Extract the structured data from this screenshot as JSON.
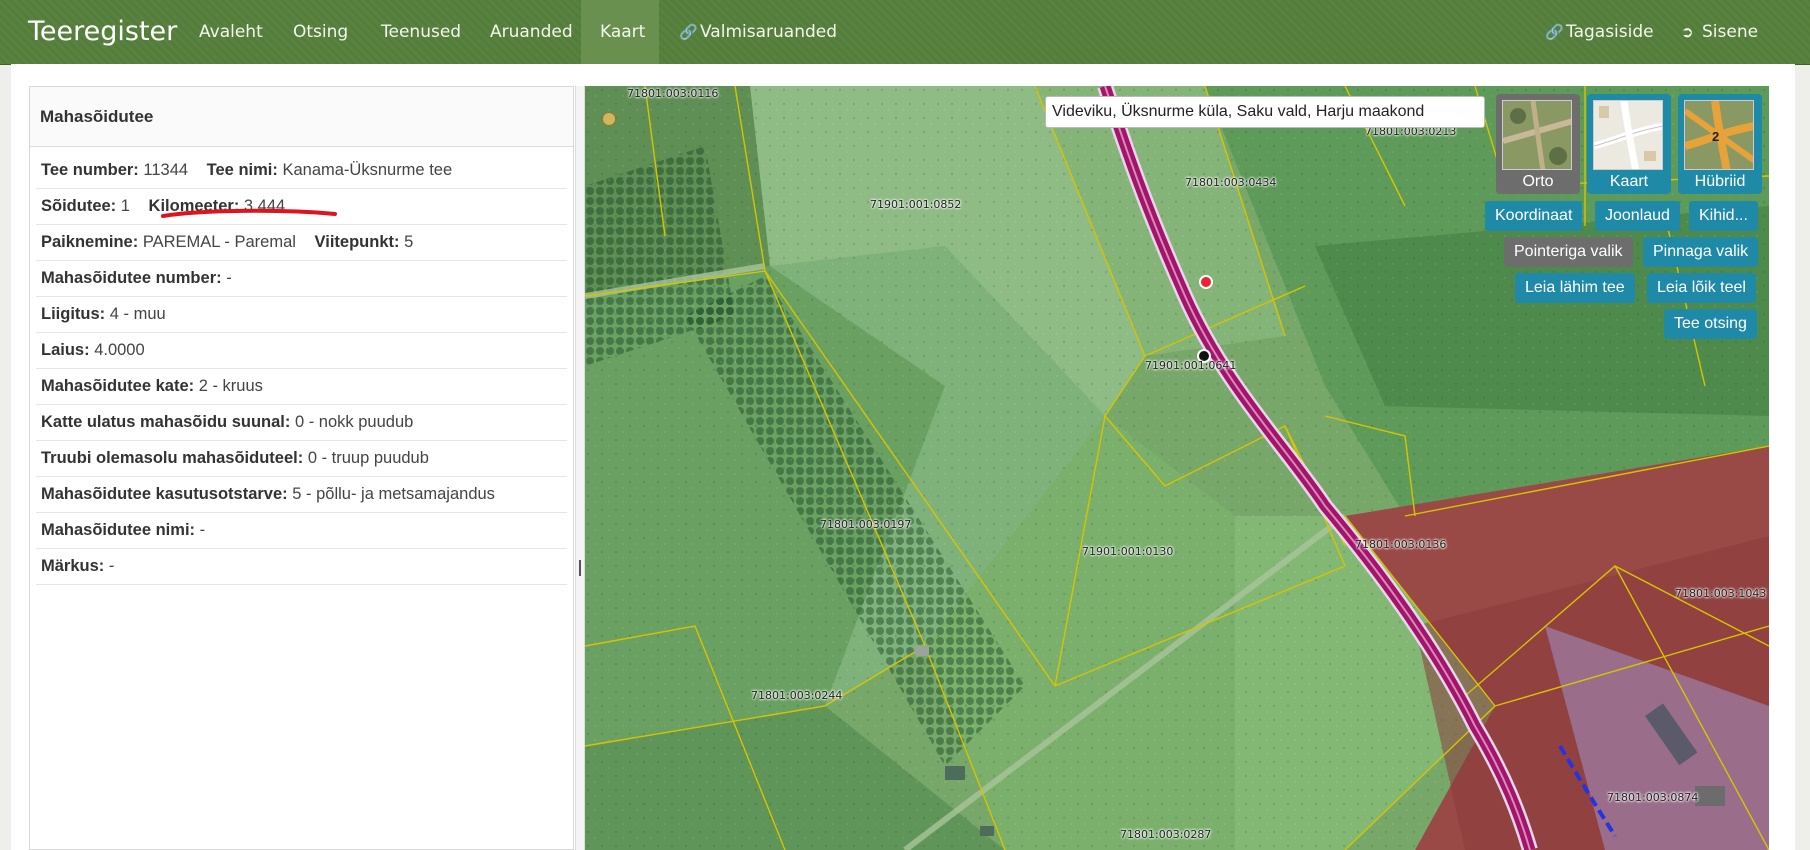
{
  "navbar": {
    "brand": "Teeregister",
    "items": [
      {
        "label": "Avaleht"
      },
      {
        "label": "Otsing"
      },
      {
        "label": "Teenused"
      },
      {
        "label": "Aruanded"
      },
      {
        "label": "Kaart",
        "active": true
      },
      {
        "label": "Valmisaruanded",
        "icon": "link-icon"
      }
    ],
    "right": [
      {
        "label": "Tagasiside",
        "icon": "link-icon"
      },
      {
        "label": "Sisene",
        "icon": "sign-in-icon"
      }
    ]
  },
  "panel": {
    "title": "Mahasõidutee",
    "rows": {
      "tee_number": {
        "label": "Tee number:",
        "value": "11344"
      },
      "tee_nimi": {
        "label": "Tee nimi:",
        "value": "Kanama-Üksnurme tee"
      },
      "soidutee": {
        "label": "Sõidutee:",
        "value": "1"
      },
      "kilomeeter": {
        "label": "Kilomeeter:",
        "value": "3.444"
      },
      "paiknemine": {
        "label": "Paiknemine:",
        "value": "PAREMAL - Paremal"
      },
      "viitepunkt": {
        "label": "Viitepunkt:",
        "value": "5"
      },
      "mahasoidutee_number": {
        "label": "Mahasõidutee number:",
        "value": "-"
      },
      "liigitus": {
        "label": "Liigitus:",
        "value": "4 - muu"
      },
      "laius": {
        "label": "Laius:",
        "value": "4.0000"
      },
      "kate": {
        "label": "Mahasõidutee kate:",
        "value": "2 - kruus"
      },
      "katte_ulatus": {
        "label": "Katte ulatus mahasõidu suunal:",
        "value": "0 - nokk puudub"
      },
      "truubi": {
        "label": "Truubi olemasolu mahasõiduteel:",
        "value": "0 - truup puudub"
      },
      "kasutusotstarve": {
        "label": "Mahasõidutee kasutusotstarve:",
        "value": "5 - põllu- ja metsamajandus"
      },
      "nimi": {
        "label": "Mahasõidutee nimi:",
        "value": "-"
      },
      "markus": {
        "label": "Märkus:",
        "value": "-"
      }
    }
  },
  "map": {
    "address": "Videviku, Üksnurme küla, Saku vald, Harju maakond",
    "layers": [
      {
        "label": "Orto",
        "selected": true
      },
      {
        "label": "Kaart"
      },
      {
        "label": "Hübriid",
        "badge": "2"
      }
    ],
    "buttons": {
      "koordinaat": "Koordinaat",
      "joonlaud": "Joonlaud",
      "kihid": "Kihid...",
      "pointeriga": "Pointeriga valik",
      "pinnaga": "Pinnaga valik",
      "leia_lahim": "Leia lähim tee",
      "leia_loik": "Leia lõik teel",
      "tee_otsing": "Tee otsing"
    },
    "parcel_labels": {
      "p0116": "71801:003:0116",
      "p0213": "71801:003:0213",
      "p0434": "71801:003:0434",
      "p0852": "71901:001:0852",
      "p0641": "71901:001:0641",
      "p0197": "71801:003:0197",
      "p0130": "71901:001:0130",
      "p0136": "71801:003:0136",
      "p1043": "71801:003:1043",
      "p0244": "71801:003:0244",
      "p0874": "71801:003:0874",
      "p0287": "71801:003:0287"
    },
    "colors": {
      "road": "#a3146b",
      "parcel_border": "#d6c400",
      "red_zone": "#9a3f42",
      "accent_teal": "#1f8aa8"
    }
  }
}
